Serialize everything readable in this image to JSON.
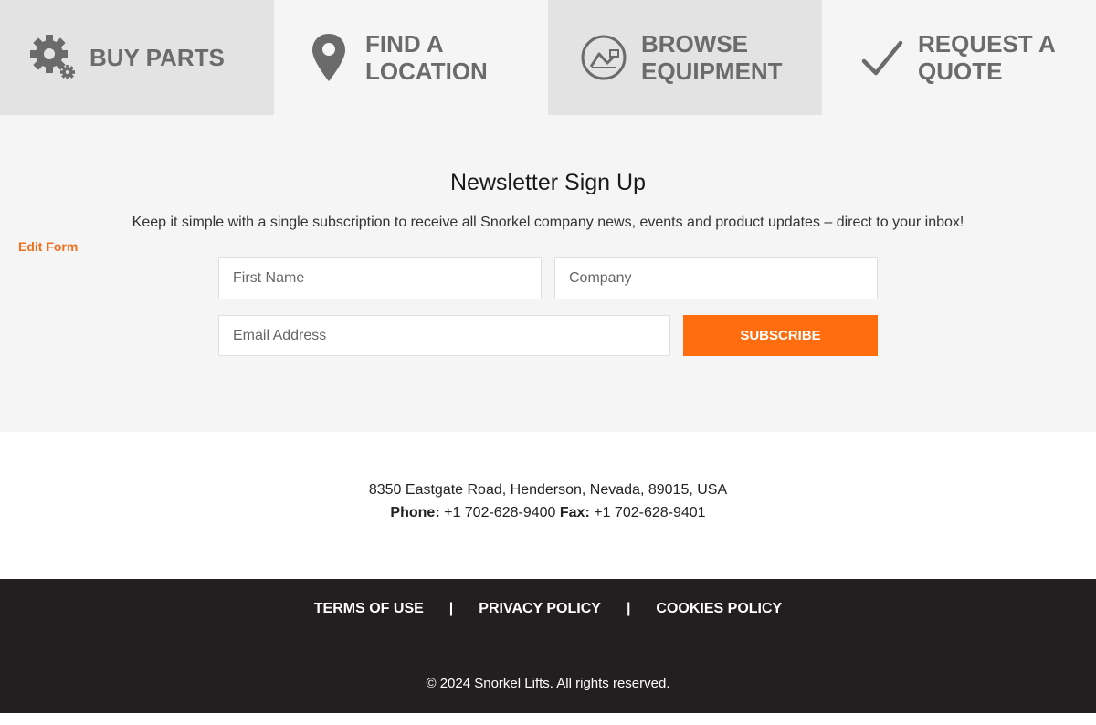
{
  "tabs": [
    {
      "label_1": "BUY PARTS",
      "label_2": "",
      "icon": "gears-icon"
    },
    {
      "label_1": "FIND A",
      "label_2": "LOCATION",
      "icon": "map-pin-icon"
    },
    {
      "label_1": "BROWSE",
      "label_2": "EQUIPMENT",
      "icon": "boom-lift-icon"
    },
    {
      "label_1": "REQUEST A",
      "label_2": "QUOTE",
      "icon": "checkmark-icon"
    }
  ],
  "newsletter": {
    "title": "Newsletter Sign Up",
    "description": "Keep it simple with a single subscription to receive all Snorkel company news, events and product updates – direct to your inbox!",
    "edit_form": "Edit Form",
    "first_name_placeholder": "First Name",
    "company_placeholder": "Company",
    "email_placeholder": "Email Address",
    "subscribe_label": "SUBSCRIBE",
    "subscribe_color": "#ff6d0e"
  },
  "contact": {
    "address": "8350 Eastgate Road, Henderson, Nevada, 89015, USA",
    "phone_label": "Phone:",
    "phone": "+1 702-628-9400",
    "fax_label": "Fax:",
    "fax": "+1 702-628-9401"
  },
  "footer": {
    "links": [
      "TERMS OF USE",
      "PRIVACY POLICY",
      "COOKIES POLICY"
    ],
    "separator": "|",
    "copyright": "© 2024 Snorkel Lifts. All rights reserved.",
    "background": "#231f20"
  }
}
